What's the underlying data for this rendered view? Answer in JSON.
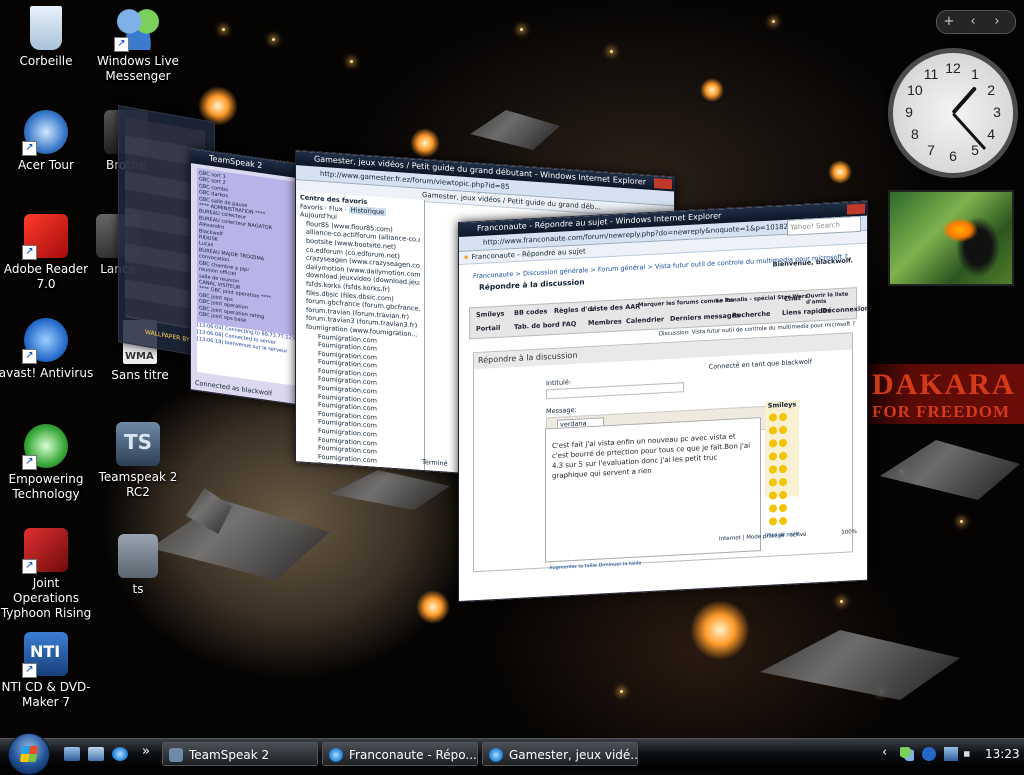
{
  "desktop": {
    "icons": [
      {
        "label": "Corbeille",
        "icon": "recycle-bin-icon"
      },
      {
        "label": "Windows Live Messenger",
        "icon": "messenger-icon"
      },
      {
        "label": "Acer Tour",
        "icon": "acer-tour-icon"
      },
      {
        "label": "Brothe",
        "icon": "brother-icon"
      },
      {
        "label": "Adobe Reader 7.0",
        "icon": "adobe-reader-icon"
      },
      {
        "label": "Lance",
        "icon": "lance-icon"
      },
      {
        "label": "avast! Antivirus",
        "icon": "avast-icon"
      },
      {
        "label": "Sans titre",
        "icon": "wma-file-icon"
      },
      {
        "label": "Empowering Technology",
        "icon": "empowering-technology-icon"
      },
      {
        "label": "Teamspeak 2 RC2",
        "icon": "teamspeak-icon"
      },
      {
        "label": "Joint Operations Typhoon Rising",
        "icon": "joint-operations-icon"
      },
      {
        "label": "ts",
        "icon": "ts-file-icon"
      },
      {
        "label": "NTI CD & DVD-Maker 7",
        "icon": "nti-icon"
      }
    ],
    "wma_badge": "WMA",
    "ts_badge": "TS",
    "nti_badge": "NTI"
  },
  "gadgets": {
    "sidebar_controls": [
      "+",
      "‹",
      "›"
    ],
    "clock_numbers": [
      "12",
      "1",
      "2",
      "3",
      "4",
      "5",
      "6",
      "7",
      "8",
      "9",
      "10",
      "11"
    ],
    "clock_time": {
      "hour": 1,
      "minute": 23
    },
    "dakara": {
      "line1": "DAKARA",
      "line2": "FOR FREEDOM"
    }
  },
  "flip3d": {
    "teamspeak_window": {
      "title": "TeamSpeak 2",
      "status": "Connected as blackwolf",
      "log_lines": [
        "[13:06:04] Connecting to 88.73.77.123:8767",
        "[13:06:08] Connected to server",
        "[13:06:18] bienvenue sur le serveur"
      ],
      "tree_items": [
        "GBC sort 1",
        "GBC sort 2",
        "GBC combo",
        "GBC darkos",
        "GBC salle de pause",
        "**** ADMINISTRATION ****",
        "BUREAU collecteur",
        "BUREAU collecteur NAGATOR",
        "Alexandro",
        "Blackwolf",
        "RIDUSK",
        "Lucas",
        "BUREAU MAJOR TROIZIMA",
        "convocation",
        "GBC chambre a pipi",
        "reunion officiel",
        "salle de reunion",
        "CANAL VISITEUR",
        "**** GBC joint operation ****",
        "GBC joint ops",
        "GBC joint operation",
        "GBC joint operation rating",
        "GBC joint ops base"
      ]
    },
    "gamester_window": {
      "title": "Gamester, jeux vidéos / Petit guide du grand débutant - Windows Internet Explorer",
      "address": "http://www.gamester.fr.ez/forum/viewtopic.php?id=85",
      "tab": "Gamester, jeux vidéos / Petit guide du grand déb...",
      "fav_tabs": [
        "Favoris",
        "Flux",
        "Historique"
      ],
      "fav_header": "Centre des favoris",
      "history_header": "Aujourd'hui",
      "history_items": [
        "flour85 (www.flour85.com)",
        "alliance-co.actifforum (alliance-co.a...",
        "bootsite (www.bootsite.net)",
        "co.edforum (co.edforum.net)",
        "crazyseagen (www.crazyseagen.co...",
        "dailymotion (www.dailymotion.com)",
        "download.jeuxvideo (download.jeux...",
        "fsfds.korks (fsfds.korks.fr)",
        "files.dbsic (files.dbsic.com)",
        "forum.gbcfrance (forum.gbcfrance...",
        "forum.travian (forum.travian.fr)",
        "forum.travian3 (forum.travian3.fr)",
        "foumigration (www.foumigration...",
        "Foumigration.com",
        "Foumigration.com",
        "Foumigration.com",
        "Foumigration.com",
        "Foumigration.com",
        "Foumigration.com",
        "Foumigration.com",
        "Foumigration.com",
        "Foumigration.com",
        "Foumigration.com",
        "Foumigration.com",
        "Foumigration.com",
        "Foumigration.com",
        "Foumigration.com",
        "Foumigration.com",
        "Foumigration.com",
        "Foumigration.com",
        "Foumigration.com"
      ],
      "status": "Terminé"
    },
    "franconaute_window": {
      "title": "Franconaute - Répondre au sujet - Windows Internet Explorer",
      "address": "http://www.franconaute.com/forum/newreply.php?do=newreply&noquote=1&p=10182",
      "search_placeholder": "Yahoo! Search",
      "tab": "Franconaute - Répondre au sujet",
      "breadcrumb": "Franconaute > Discussion générale > Forum général > Vista futur outil de controle du multimedia pour microsoft ?",
      "page_heading": "Répondre à la discussion",
      "welcome": "Bienvenue, blackwolf.",
      "nav_top": [
        "Smileys",
        "BB codes",
        "Règles d'or",
        "Liste des AAR",
        "Marquer les forums comme lus",
        "Le Penalis - spécial Star Wars",
        "Chat",
        "Ouvrir la liste d'amis"
      ],
      "nav_bottom": [
        "Portail",
        "Tab. de bord",
        "FAQ",
        "Membres",
        "Calendrier",
        "Derniers messages",
        "Recherche",
        "Liens rapides",
        "Déconnexion"
      ],
      "section_title": "Répondre à la discussion",
      "discussion_label": "Discussion: Vista futur outil de controle du multimedia pour microsoft ?",
      "logged_as": "Connecté en tant que blackwolf",
      "title_label": "Intitulé:",
      "message_label": "Message:",
      "font_value": "verdana",
      "message_text": "C'est fait j'ai vista enfin un nouveau pc avec vista et c'est bourré de prtection pour tous ce que je fait.Bon j'ai 4.3 sur 5 sur l'evaluation donc j'ai les petit truc graphique qui servent a rien",
      "smileys_title": "Smileys",
      "smileys_more": "[Plus de smileys]",
      "resize_links": "Augmenter la taille  Diminuer la taille",
      "status_zone": "Internet | Mode protégé : activé",
      "zoom": "100%"
    },
    "mini_window": {
      "overlay": "WALLPAPER BY GILLES"
    }
  },
  "taskbar": {
    "buttons": [
      {
        "label": "TeamSpeak 2",
        "icon": "teamspeak-icon"
      },
      {
        "label": "Franconaute - Répo...",
        "icon": "ie-icon"
      },
      {
        "label": "Gamester, jeux vidé...",
        "icon": "ie-icon"
      }
    ],
    "quick_launch": [
      "show-desktop-icon",
      "switch-windows-icon",
      "ie-icon"
    ],
    "chevron": "»",
    "tray_chevron": "‹",
    "time": "13:23"
  }
}
